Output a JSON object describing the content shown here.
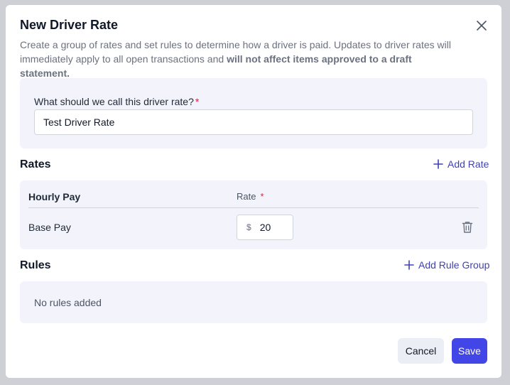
{
  "modal": {
    "title": "New Driver Rate",
    "description_plain": "Create a group of rates and set rules to determine how a driver is paid. Updates to driver rates will immediately apply to all open transactions and ",
    "description_bold": "will not affect items approved to a draft statement."
  },
  "name_field": {
    "label": "What should we call this driver rate?",
    "required_mark": "*",
    "value": "Test Driver Rate"
  },
  "rates": {
    "heading": "Rates",
    "add_label": "Add Rate",
    "col_name": "Hourly Pay",
    "col_rate": "Rate",
    "required_mark": "*",
    "rows": [
      {
        "label": "Base Pay",
        "currency": "$",
        "value": "20"
      }
    ]
  },
  "rules": {
    "heading": "Rules",
    "add_label": "Add Rule Group",
    "empty_text": "No rules added"
  },
  "actions": {
    "cancel_label": "Cancel",
    "save_label": "Save"
  },
  "colors": {
    "accent": "#4346e6",
    "link": "#3f41b8",
    "required": "#e11d48",
    "panel": "#f3f4fb"
  }
}
